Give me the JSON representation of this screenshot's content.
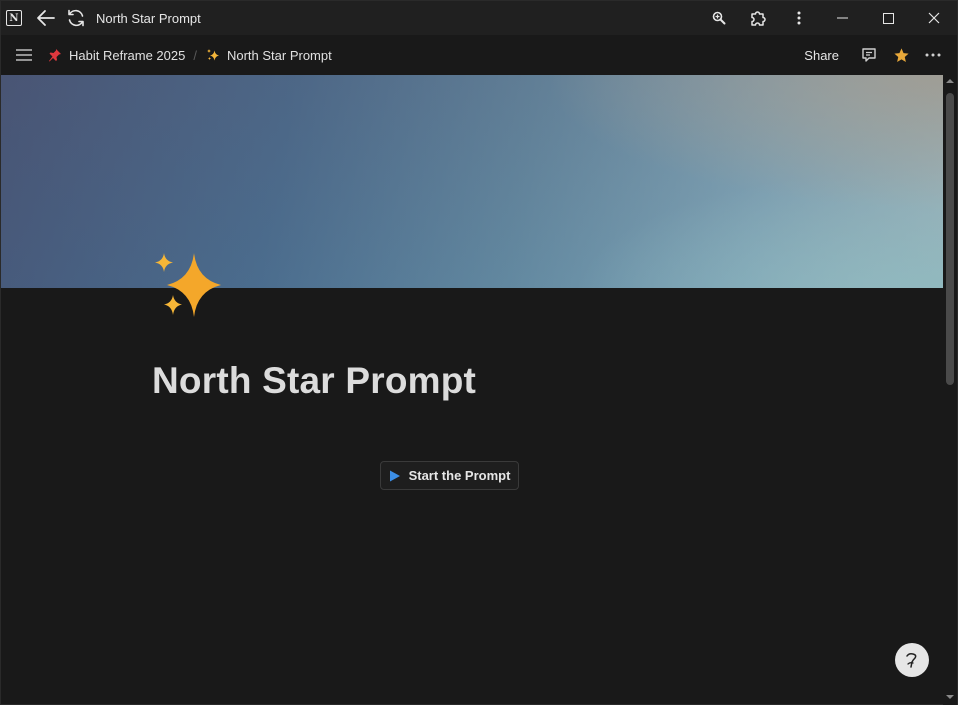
{
  "window": {
    "title": "North Star Prompt",
    "app_icon_letter": "N"
  },
  "icons": {
    "app": "notion-app-icon",
    "back": "arrow-left-icon",
    "reload": "reload-icon",
    "zoom": "zoom-icon",
    "extensions": "puzzle-icon",
    "more_vertical": "more-vertical-icon",
    "minimize": "minimize-icon",
    "maximize": "maximize-icon",
    "close": "close-icon",
    "menu": "hamburger-menu-icon",
    "comment": "comment-icon",
    "favorite": "star-icon",
    "more_horizontal": "more-horizontal-icon",
    "page": "sparkles-icon",
    "play": "play-icon",
    "help": "help-icon"
  },
  "breadcrumb": {
    "items": [
      {
        "label": "Habit Reframe 2025",
        "emoji": "📌"
      },
      {
        "label": "North Star Prompt",
        "emoji": "✨"
      }
    ],
    "separator": "/"
  },
  "toolbar": {
    "share_label": "Share"
  },
  "page": {
    "title": "North Star Prompt",
    "button_label": "Start the Prompt"
  },
  "colors": {
    "accent_star": "#f4a72a",
    "play_blue": "#3c8ee6",
    "favorite_star": "#e8a83a",
    "background": "#191919"
  }
}
